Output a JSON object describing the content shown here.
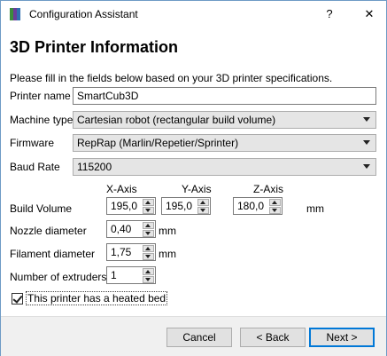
{
  "window": {
    "title": "Configuration Assistant",
    "help_label": "?",
    "close_label": "✕"
  },
  "page": {
    "heading": "3D Printer Information",
    "intro": "Please fill in the fields below based on your 3D printer specifications."
  },
  "fields": {
    "printer_name": {
      "label": "Printer name",
      "value": "SmartCub3D"
    },
    "machine_type": {
      "label": "Machine type",
      "value": "Cartesian robot (rectangular build volume)"
    },
    "firmware": {
      "label": "Firmware",
      "value": "RepRap (Marlin/Repetier/Sprinter)"
    },
    "baud_rate": {
      "label": "Baud Rate",
      "value": "115200"
    },
    "build_volume": {
      "label": "Build Volume",
      "x_header": "X-Axis",
      "y_header": "Y-Axis",
      "z_header": "Z-Axis",
      "x": "195,0",
      "y": "195,0",
      "z": "180,0",
      "unit": "mm"
    },
    "nozzle_diameter": {
      "label": "Nozzle diameter",
      "value": "0,40",
      "unit": "mm"
    },
    "filament_diameter": {
      "label": "Filament diameter",
      "value": "1,75",
      "unit": "mm"
    },
    "extruders": {
      "label": "Number of extruders",
      "value": "1"
    },
    "heated_bed": {
      "label": "This printer has a heated bed",
      "checked": true
    }
  },
  "buttons": {
    "cancel": "Cancel",
    "back": "< Back",
    "next": "Next >"
  },
  "colors": {
    "window_border": "#6e9bc5",
    "footer_bg": "#f0f0f0",
    "default_button_border": "#0078d7"
  },
  "icons": {
    "app": "cura-icon",
    "help": "question-icon",
    "close": "close-icon"
  }
}
